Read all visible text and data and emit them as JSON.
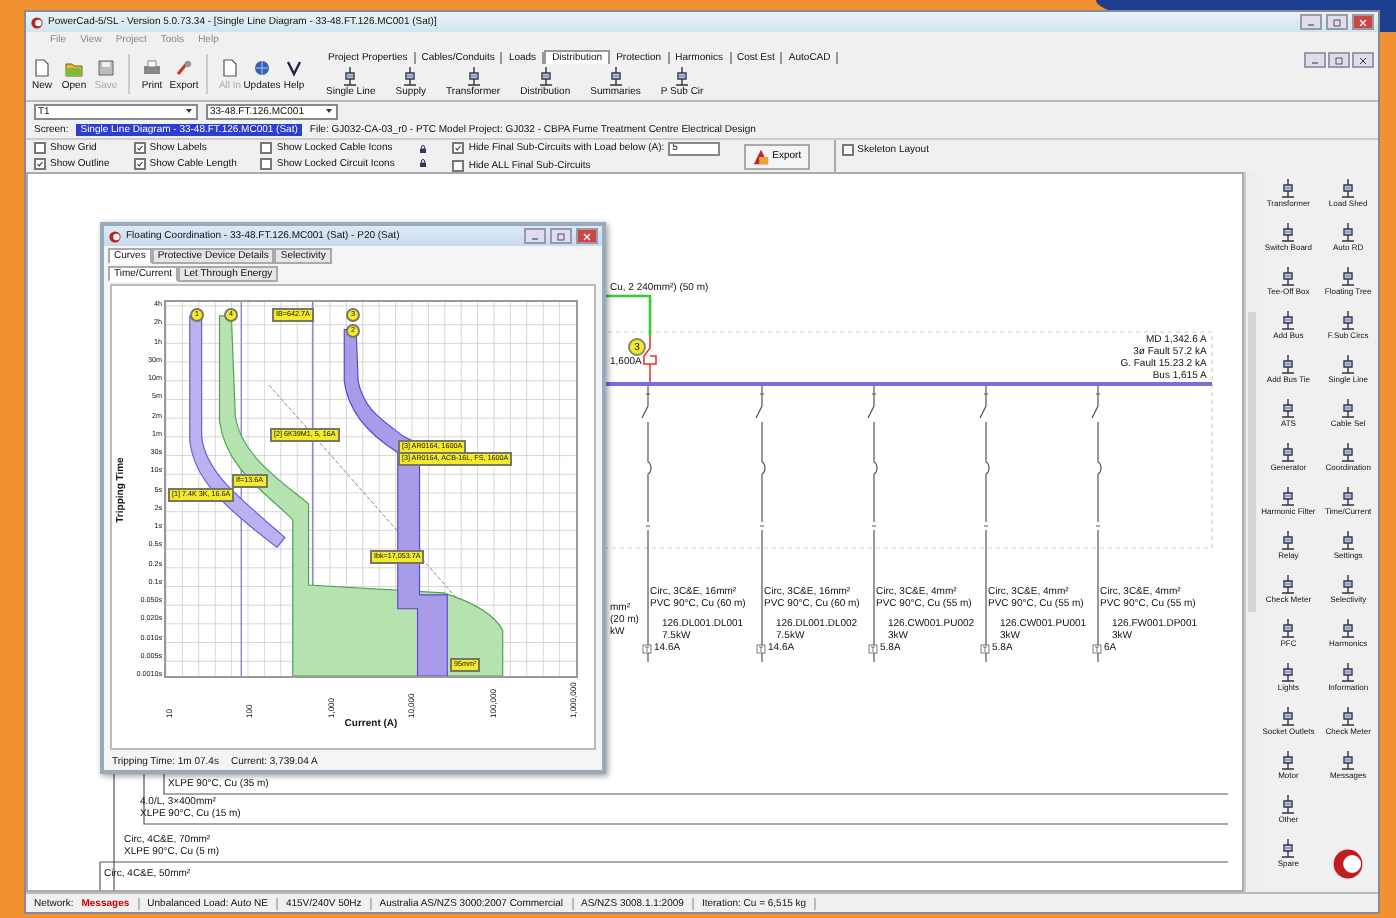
{
  "window": {
    "title": "PowerCad-5/SL - Version 5.0.73.34 - [Single Line Diagram - 33-48.FT.126.MC001 (Sat)]"
  },
  "menu": [
    "File",
    "View",
    "Project",
    "Tools",
    "Help"
  ],
  "toolbar": [
    {
      "label": "New",
      "disabled": false
    },
    {
      "label": "Open",
      "disabled": false
    },
    {
      "label": "Save",
      "disabled": true
    },
    {
      "label": "Print",
      "disabled": false
    },
    {
      "label": "Export",
      "disabled": false
    },
    {
      "label": "All In",
      "disabled": true
    },
    {
      "label": "Updates",
      "disabled": false
    },
    {
      "label": "Help",
      "disabled": false
    }
  ],
  "tabs": [
    {
      "label": "Project Properties",
      "selected": false
    },
    {
      "label": "Cables/Conduits",
      "selected": false
    },
    {
      "label": "Loads",
      "selected": false
    },
    {
      "label": "Distribution",
      "selected": true
    },
    {
      "label": "Protection",
      "selected": false
    },
    {
      "label": "Harmonics",
      "selected": false
    },
    {
      "label": "Cost Est",
      "selected": false
    },
    {
      "label": "AutoCAD",
      "selected": false
    }
  ],
  "ribbon": [
    "Single Line",
    "Supply",
    "Transformer",
    "Distribution",
    "Summaries",
    "P Sub Cir"
  ],
  "selectors": {
    "board": "T1",
    "circuit": "33-48.FT.126.MC001"
  },
  "screen": {
    "label": "Screen:",
    "name": "Single Line Diagram - 33-48.FT.126.MC001 (Sat)",
    "info": "File: GJ032-CA-03_r0 - PTC Model   Project: GJ032 - CBPA Fume Treatment Centre Electrical Design"
  },
  "option_columns": [
    [
      {
        "label": "Show Grid",
        "checked": false
      },
      {
        "label": "Show Outline",
        "checked": true
      }
    ],
    [
      {
        "label": "Show Labels",
        "checked": true
      },
      {
        "label": "Show Cable Length",
        "checked": true
      }
    ],
    [
      {
        "label": "Show Locked Cable Icons",
        "checked": false
      },
      {
        "label": "Show Locked Circuit Icons",
        "checked": false
      }
    ],
    [
      {
        "label": "Hide Final Sub-Circuits with Load below (A):",
        "checked": true
      },
      {
        "label": "Hide ALL Final Sub-Circuits",
        "checked": false
      }
    ]
  ],
  "load_threshold": "5",
  "export_button": "Export",
  "skeleton_layout": {
    "label": "Skeleton Layout",
    "checked": false
  },
  "floating_window": {
    "title": "Floating Coordination - 33-48.FT.126.MC001 (Sat) - P20 (Sat)",
    "tabs": [
      {
        "label": "Curves",
        "selected": true
      },
      {
        "label": "Protective Device Details",
        "selected": false
      },
      {
        "label": "Selectivity",
        "selected": false
      }
    ],
    "subtabs": [
      {
        "label": "Time/Current",
        "selected": true
      },
      {
        "label": "Let Through Energy",
        "selected": false
      }
    ],
    "y_axis_title": "Tripping Time",
    "x_axis_title": "Current (A)",
    "y_ticks": [
      "4h",
      "2h",
      "1h",
      "30m",
      "10m",
      "5m",
      "2m",
      "1m",
      "30s",
      "10s",
      "5s",
      "2s",
      "1s",
      "0.5s",
      "0.2s",
      "0.1s",
      "0.050s",
      "0.020s",
      "0.010s",
      "0.005s",
      "0.0010s"
    ],
    "x_ticks": [
      "10",
      "100",
      "1,000",
      "10,000",
      "100,000",
      "1,000,000"
    ],
    "tags": [
      {
        "text": "1",
        "kind": "marker"
      },
      {
        "text": "4",
        "kind": "marker"
      },
      {
        "text": "IB=642.7A",
        "kind": "tag"
      },
      {
        "text": "3",
        "kind": "marker"
      },
      {
        "text": "2",
        "kind": "marker"
      },
      {
        "text": "[2] 6K39M1, 5, 16A",
        "kind": "tag"
      },
      {
        "text": "[3] AR0164, 1600A",
        "kind": "tag"
      },
      {
        "text": "[3] AR0164, ACB-16L, FS, 1600A",
        "kind": "tag"
      },
      {
        "text": "If=13.6A",
        "kind": "tag"
      },
      {
        "text": "[1] 7.4K 3K, 16.6A",
        "kind": "tag"
      },
      {
        "text": "Ibk=17,053.7A",
        "kind": "tag"
      },
      {
        "text": "95mm²",
        "kind": "tag"
      }
    ],
    "footer": [
      "Tripping Time: 1m 07.4s",
      "Current: 3,739.04 A"
    ]
  },
  "diagram": {
    "incomer": {
      "cable": "Cu, 2 240mm²) (50 m)",
      "marker": "3",
      "rating": "1,600A"
    },
    "bus_info": [
      "MD 1,342.6 A",
      "3ø Fault 57.2 kA",
      "G. Fault 15.23.2 kA",
      "Bus 1,615 A"
    ],
    "cut_labels": [
      "mm²",
      "(20 m)",
      "kW"
    ],
    "feeders": [
      {
        "cable": "Circ, 3C&E, 16mm²",
        "insulation": "PVC 90°C, Cu (60 m)",
        "load_id": "126.DL001.DL001",
        "power": "7.5kW",
        "current": "14.6A"
      },
      {
        "cable": "Circ, 3C&E, 16mm²",
        "insulation": "PVC 90°C, Cu (60 m)",
        "load_id": "126.DL001.DL002",
        "power": "7.5kW",
        "current": "14.6A"
      },
      {
        "cable": "Circ, 3C&E, 4mm²",
        "insulation": "PVC 90°C, Cu (55 m)",
        "load_id": "126.CW001.PU002",
        "power": "3kW",
        "current": "5.8A"
      },
      {
        "cable": "Circ, 3C&E, 4mm²",
        "insulation": "PVC 90°C, Cu (55 m)",
        "load_id": "126.CW001.PU001",
        "power": "3kW",
        "current": "5.8A"
      },
      {
        "cable": "Circ, 3C&E, 4mm²",
        "insulation": "PVC 90°C, Cu (55 m)",
        "load_id": "126.FW001.DP001",
        "power": "3kW",
        "current": "6A"
      }
    ],
    "lower_cables": [
      {
        "lines": [
          "XLPE 90°C, Cu (35 m)"
        ]
      },
      {
        "lines": [
          "4.0/L, 3×400mm²",
          "XLPE 90°C, Cu (15 m)"
        ]
      },
      {
        "lines": [
          "Circ, 4C&E, 70mm²",
          "XLPE 90°C, Cu (5 m)"
        ]
      },
      {
        "lines": [
          "Circ, 4C&E, 50mm²"
        ]
      }
    ]
  },
  "palette_left": [
    "Transformer",
    "Switch Board",
    "Tee-Off Box",
    "Add Bus",
    "Add Bus Tie",
    "ATS",
    "Generator",
    "Harmonic Filter",
    "Relay",
    "Check Meter",
    "PFC",
    "Lights",
    "Socket Outlets",
    "Motor",
    "Other",
    "Spare"
  ],
  "palette_right": [
    "Load Shed",
    "Auto RD",
    "Floating Tree",
    "F.Sub Circs",
    "Single Line",
    "Cable Sel",
    "Coordination",
    "Time/Current",
    "Settings",
    "Selectivity",
    "Harmonics",
    "Information",
    "Check Meter",
    "Messages"
  ],
  "status_bar": [
    {
      "text": "Network:",
      "kind": "label"
    },
    {
      "text": "Messages",
      "kind": "alert"
    },
    {
      "text": "Unbalanced Load: Auto NE",
      "kind": "field"
    },
    {
      "text": "415V/240V 50Hz",
      "kind": "field"
    },
    {
      "text": "Australia AS/NZS 3000:2007 Commercial",
      "kind": "field"
    },
    {
      "text": "AS/NZS 3008.1.1:2009",
      "kind": "field"
    },
    {
      "text": "Iteration: Cu = 6,515 kg",
      "kind": "field"
    }
  ]
}
